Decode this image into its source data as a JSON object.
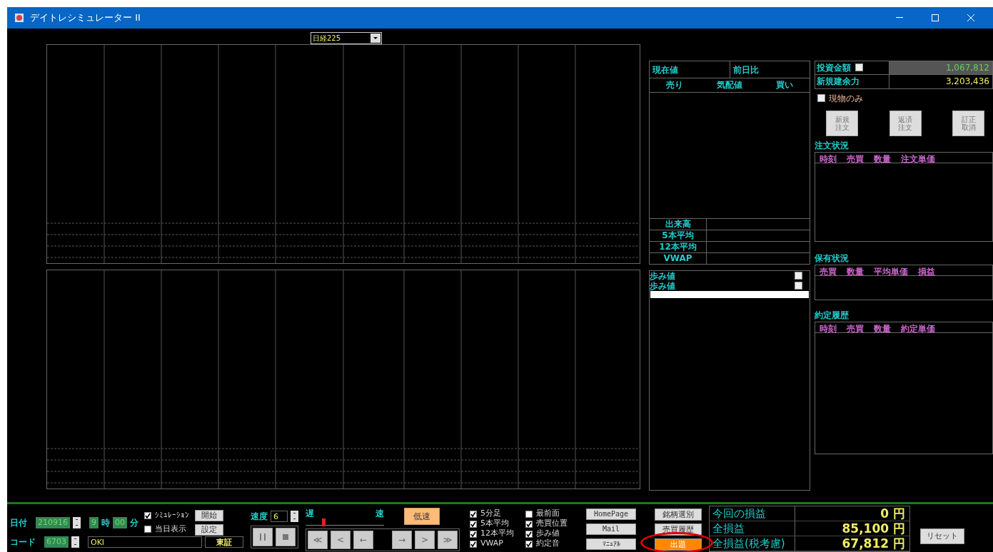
{
  "window": {
    "title": "デイトレシミュレーター II"
  },
  "symbol_select": {
    "value": "日経225"
  },
  "quote_panel": {
    "price_label": "現在値",
    "change_label": "前日比",
    "columns": [
      "売り",
      "気配値",
      "買い"
    ],
    "stats": [
      "出来高",
      "5本平均",
      "12本平均",
      "VWAP"
    ]
  },
  "tape": {
    "titles": [
      {
        "label": "歩み値",
        "checked": false
      },
      {
        "label": "歩み値",
        "checked": false
      }
    ]
  },
  "investment": {
    "label": "投資金額",
    "checked": false,
    "value": "1,067,812"
  },
  "buying_power": {
    "label": "新規建余力",
    "value": "3,203,436"
  },
  "cash_only": {
    "label": "現物のみ",
    "checked": false
  },
  "order_buttons": [
    "新規注文",
    "返済注文",
    "訂正取消"
  ],
  "order_status": {
    "title": "注文状況",
    "columns": [
      "時刻",
      "売買",
      "数量",
      "注文単価"
    ]
  },
  "positions": {
    "title": "保有状況",
    "columns": [
      "売買",
      "数量",
      "平均単価",
      "損益"
    ]
  },
  "executions": {
    "title": "約定履歴",
    "columns": [
      "時刻",
      "売買",
      "数量",
      "約定単価"
    ]
  },
  "date": {
    "label": "日付",
    "value": "210916"
  },
  "code": {
    "label": "コード",
    "value": "6703"
  },
  "time": {
    "hour": "9",
    "hour_label": "時",
    "minute": "00",
    "minute_label": "分"
  },
  "options": [
    {
      "label": "ｼﾐｭﾚｰｼｮﾝ",
      "checked": true
    },
    {
      "label": "当日表示",
      "checked": false
    }
  ],
  "control_buttons": [
    "開始",
    "設定"
  ],
  "stock_name": "OKI",
  "market": "東証",
  "speed": {
    "label": "速度",
    "value": "6",
    "slow_label": "遅",
    "fast_label": "速",
    "level": 0.22,
    "button": "低速"
  },
  "nav_buttons": [
    "≪",
    "<",
    "←",
    "→",
    ">",
    "≫"
  ],
  "display_options": [
    {
      "label": "5分足",
      "checked": true
    },
    {
      "label": "5本平均",
      "checked": true
    },
    {
      "label": "12本平均",
      "checked": true
    },
    {
      "label": "VWAP",
      "checked": true
    },
    {
      "label": "最前面",
      "checked": false
    },
    {
      "label": "売買位置",
      "checked": true
    },
    {
      "label": "歩み値",
      "checked": true
    },
    {
      "label": "約定音",
      "checked": true
    }
  ],
  "links": [
    "HomePage",
    "Mail",
    "ﾏﾆｭｱﾙ"
  ],
  "actions": [
    {
      "label": "銘柄選別",
      "highlighted": false
    },
    {
      "label": "売買履歴",
      "highlighted": false
    },
    {
      "label": "出題",
      "highlighted": true
    }
  ],
  "pnl": [
    {
      "label": "今回の損益",
      "value": "0",
      "unit": "円"
    },
    {
      "label": "全損益",
      "value": "85,100",
      "unit": "円"
    },
    {
      "label": "全損益(税考慮)",
      "value": "67,812",
      "unit": "円"
    }
  ],
  "reset_button": "リセット"
}
